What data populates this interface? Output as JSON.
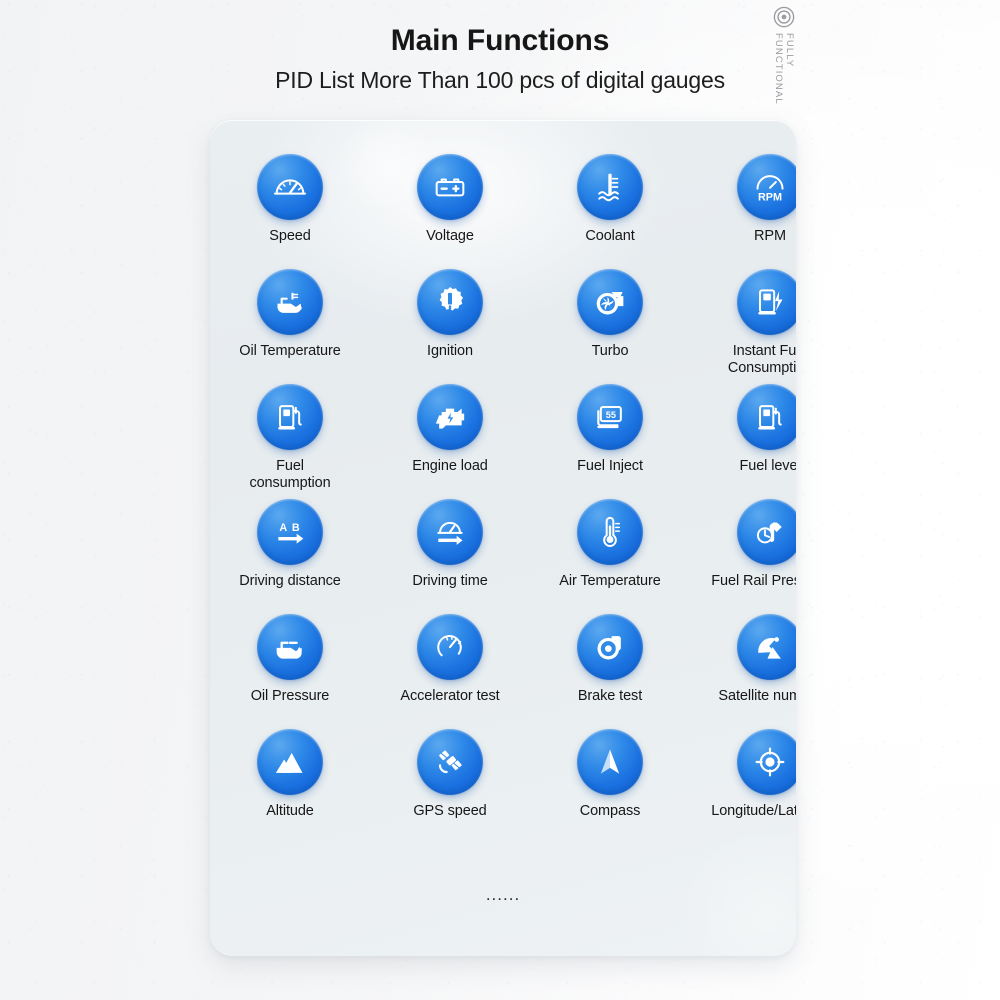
{
  "header": {
    "title": "Main Functions",
    "subtitle": "PID List More Than 100 pcs of digital gauges"
  },
  "stamp": {
    "icon": "target-icon",
    "text": "FULLY\nFUNCTIONAL"
  },
  "card": {
    "ellipsis": "......",
    "columns": 4,
    "rows": 6
  },
  "gauges": [
    {
      "label": "Speed",
      "icon": "speedometer-icon"
    },
    {
      "label": "Voltage",
      "icon": "battery-icon"
    },
    {
      "label": "Coolant",
      "icon": "coolant-thermometer-icon"
    },
    {
      "label": "RPM",
      "icon": "rpm-gauge-icon"
    },
    {
      "label": "Oil Temperature",
      "icon": "oil-can-thermometer-icon"
    },
    {
      "label": "Ignition",
      "icon": "spark-plug-gear-icon"
    },
    {
      "label": "Turbo",
      "icon": "turbocharger-icon"
    },
    {
      "label": "Instant Fuel Consumption",
      "icon": "fuel-pump-bolt-icon"
    },
    {
      "label": "Fuel\nconsumption",
      "icon": "fuel-pump-icon"
    },
    {
      "label": "Engine load",
      "icon": "engine-bolt-icon"
    },
    {
      "label": "Fuel Inject",
      "icon": "fuel-injector-icon"
    },
    {
      "label": "Fuel level",
      "icon": "fuel-level-icon"
    },
    {
      "label": "Driving distance",
      "icon": "a-to-b-arrow-icon"
    },
    {
      "label": "Driving time",
      "icon": "gauge-arrow-icon"
    },
    {
      "label": "Air Temperature",
      "icon": "thermometer-icon"
    },
    {
      "label": "Fuel Rail Pressure",
      "icon": "fuel-nozzle-pressure-icon"
    },
    {
      "label": "Oil Pressure",
      "icon": "oil-can-icon"
    },
    {
      "label": "Accelerator test",
      "icon": "accelerator-dial-icon"
    },
    {
      "label": "Brake test",
      "icon": "brake-disc-icon"
    },
    {
      "label": "Satellite number",
      "icon": "satellite-dish-icon"
    },
    {
      "label": "Altitude",
      "icon": "mountain-icon"
    },
    {
      "label": "GPS speed",
      "icon": "satellite-icon"
    },
    {
      "label": "Compass",
      "icon": "compass-needle-icon"
    },
    {
      "label": "Longitude/Latitude",
      "icon": "crosshair-location-icon"
    }
  ],
  "colors": {
    "icon_blue_light": "#5ba8ef",
    "icon_blue_dark": "#0f5fd2",
    "card_bg": "#e9eef1",
    "page_bg": "#f4f5f7",
    "text": "#171717",
    "stamp_text": "#9a9ca0"
  }
}
